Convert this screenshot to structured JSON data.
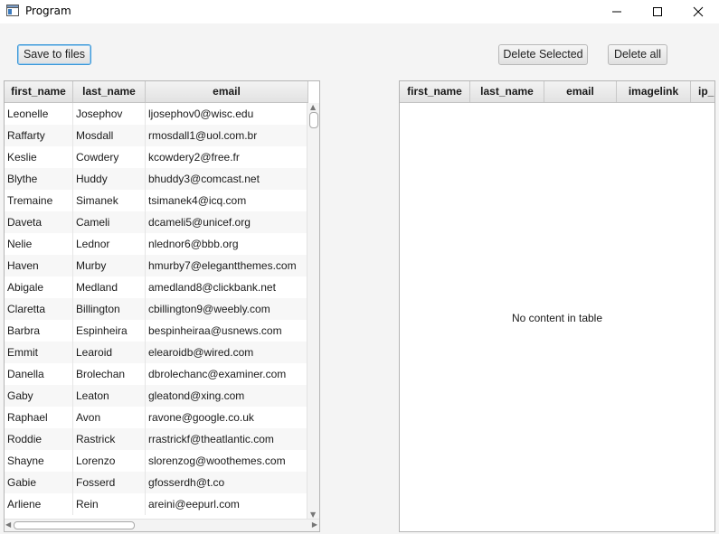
{
  "window": {
    "title": "Program"
  },
  "toolbar": {
    "save_label": "Save to files",
    "delete_selected_label": "Delete Selected",
    "delete_all_label": "Delete all"
  },
  "left_table": {
    "columns": [
      "first_name",
      "last_name",
      "email"
    ],
    "rows": [
      [
        "Leonelle",
        "Josephov",
        "ljosephov0@wisc.edu"
      ],
      [
        "Raffarty",
        "Mosdall",
        "rmosdall1@uol.com.br"
      ],
      [
        "Keslie",
        "Cowdery",
        "kcowdery2@free.fr"
      ],
      [
        "Blythe",
        "Huddy",
        "bhuddy3@comcast.net"
      ],
      [
        "Tremaine",
        "Simanek",
        "tsimanek4@icq.com"
      ],
      [
        "Daveta",
        "Cameli",
        "dcameli5@unicef.org"
      ],
      [
        "Nelie",
        "Lednor",
        "nlednor6@bbb.org"
      ],
      [
        "Haven",
        "Murby",
        "hmurby7@elegantthemes.com"
      ],
      [
        "Abigale",
        "Medland",
        "amedland8@clickbank.net"
      ],
      [
        "Claretta",
        "Billington",
        "cbillington9@weebly.com"
      ],
      [
        "Barbra",
        "Espinheira",
        "bespinheiraa@usnews.com"
      ],
      [
        "Emmit",
        "Learoid",
        "elearoidb@wired.com"
      ],
      [
        "Danella",
        "Brolechan",
        "dbrolechanc@examiner.com"
      ],
      [
        "Gaby",
        "Leaton",
        "gleatond@xing.com"
      ],
      [
        "Raphael",
        "Avon",
        "ravone@google.co.uk"
      ],
      [
        "Roddie",
        "Rastrick",
        "rrastrickf@theatlantic.com"
      ],
      [
        "Shayne",
        "Lorenzo",
        "slorenzog@woothemes.com"
      ],
      [
        "Gabie",
        "Fosserd",
        "gfosserdh@t.co"
      ],
      [
        "Arliene",
        "Rein",
        "areini@eepurl.com"
      ]
    ]
  },
  "right_table": {
    "columns": [
      "first_name",
      "last_name",
      "email",
      "imagelink",
      "ip_"
    ],
    "empty_text": "No content in table"
  }
}
